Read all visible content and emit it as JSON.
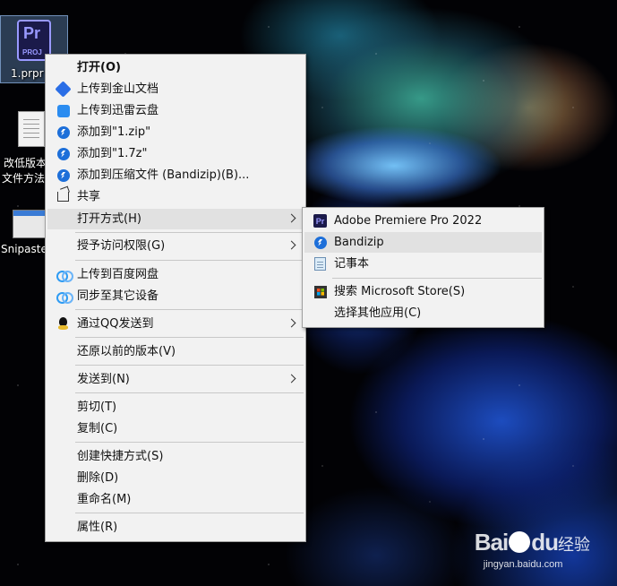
{
  "desktop": {
    "icons": [
      {
        "label": "1.prpr",
        "badge_top": "Pr",
        "badge_bottom": "PROJ"
      },
      {
        "label_line1": "改低版本",
        "label_line2": "文件方法"
      },
      {
        "label": "Snipaste"
      }
    ]
  },
  "context_menu": {
    "items": [
      {
        "label": "打开(O)"
      },
      {
        "label": "上传到金山文档"
      },
      {
        "label": "上传到迅雷云盘"
      },
      {
        "label": "添加到\"1.zip\""
      },
      {
        "label": "添加到\"1.7z\""
      },
      {
        "label": "添加到压缩文件 (Bandizip)(B)..."
      },
      {
        "label": "共享"
      },
      {
        "label": "打开方式(H)"
      },
      {
        "label": "授予访问权限(G)"
      },
      {
        "label": "上传到百度网盘"
      },
      {
        "label": "同步至其它设备"
      },
      {
        "label": "通过QQ发送到"
      },
      {
        "label": "还原以前的版本(V)"
      },
      {
        "label": "发送到(N)"
      },
      {
        "label": "剪切(T)"
      },
      {
        "label": "复制(C)"
      },
      {
        "label": "创建快捷方式(S)"
      },
      {
        "label": "删除(D)"
      },
      {
        "label": "重命名(M)"
      },
      {
        "label": "属性(R)"
      }
    ]
  },
  "open_with_submenu": {
    "items": [
      {
        "label": "Adobe Premiere Pro 2022",
        "icon_text": "Pr"
      },
      {
        "label": "Bandizip"
      },
      {
        "label": "记事本"
      },
      {
        "label": "搜索 Microsoft Store(S)"
      },
      {
        "label": "选择其他应用(C)"
      }
    ]
  },
  "watermark": {
    "logo_a": "Bai",
    "logo_b": "du",
    "logo_c": "经验",
    "url": "jingyan.baidu.com"
  },
  "colors": {
    "menu_bg": "#f2f2f2",
    "highlight": "#e1e1e1",
    "premiere": "#9999ff"
  }
}
